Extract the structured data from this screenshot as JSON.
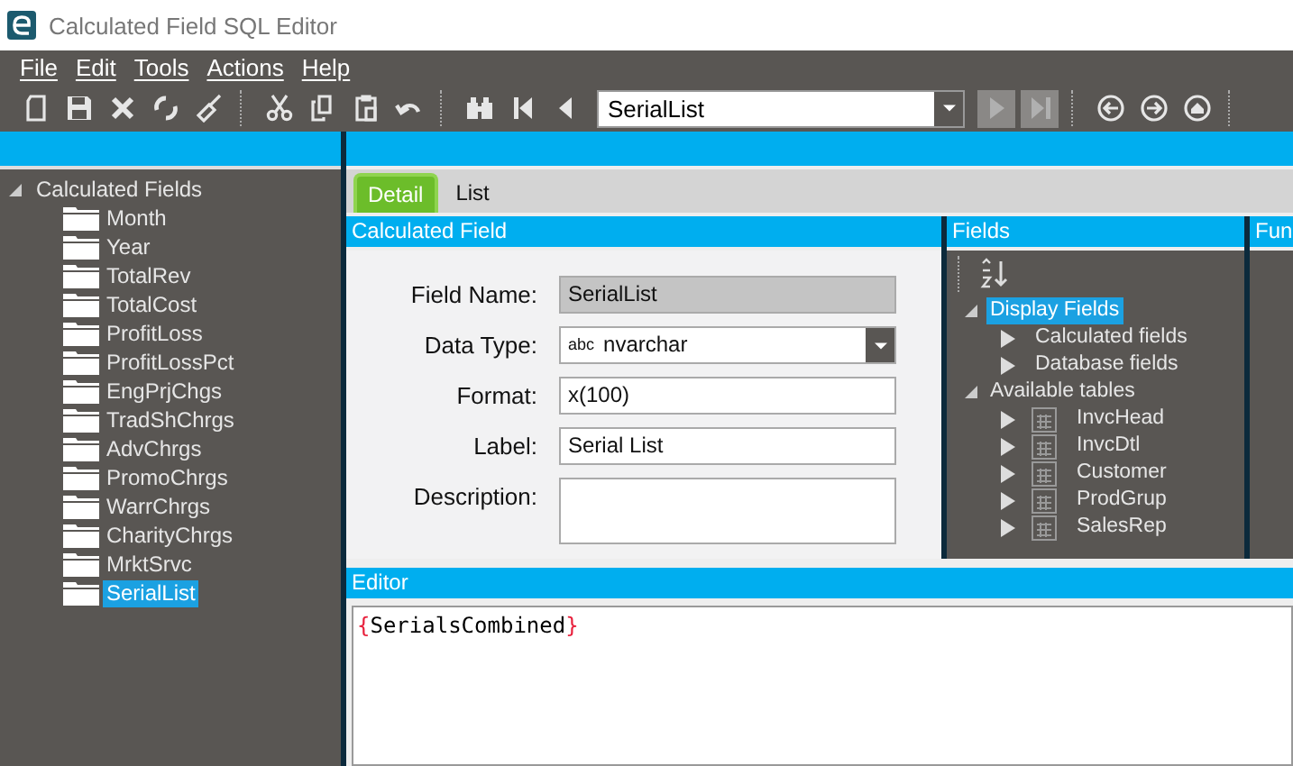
{
  "window": {
    "title": "Calculated Field SQL Editor"
  },
  "menu": [
    "File",
    "Edit",
    "Tools",
    "Actions",
    "Help"
  ],
  "toolbar": [
    {
      "kind": "new",
      "disabled": false
    },
    {
      "kind": "save",
      "disabled": false
    },
    {
      "kind": "delete",
      "disabled": false
    },
    {
      "kind": "refresh",
      "disabled": false
    },
    {
      "kind": "clear",
      "disabled": false
    },
    {
      "kind": "sep"
    },
    {
      "kind": "cut",
      "disabled": false
    },
    {
      "kind": "copy",
      "disabled": false
    },
    {
      "kind": "paste",
      "disabled": false
    },
    {
      "kind": "undo",
      "disabled": false
    },
    {
      "kind": "sep"
    },
    {
      "kind": "find",
      "disabled": false
    },
    {
      "kind": "first",
      "disabled": false
    },
    {
      "kind": "prev",
      "disabled": false
    },
    {
      "kind": "combo",
      "value": "SerialList"
    },
    {
      "kind": "next",
      "disabled": true
    },
    {
      "kind": "last",
      "disabled": true
    },
    {
      "kind": "sep"
    },
    {
      "kind": "back",
      "disabled": false
    },
    {
      "kind": "forward",
      "disabled": false
    },
    {
      "kind": "home",
      "disabled": false
    },
    {
      "kind": "sep"
    }
  ],
  "tree": {
    "label": "Calculated Fields",
    "expanded": true,
    "children": [
      {
        "label": "Month",
        "selected": false
      },
      {
        "label": "Year",
        "selected": false
      },
      {
        "label": "TotalRev",
        "selected": false
      },
      {
        "label": "TotalCost",
        "selected": false
      },
      {
        "label": "ProfitLoss",
        "selected": false
      },
      {
        "label": "ProfitLossPct",
        "selected": false
      },
      {
        "label": "EngPrjChgs",
        "selected": false
      },
      {
        "label": "TradShChrgs",
        "selected": false
      },
      {
        "label": "AdvChrgs",
        "selected": false
      },
      {
        "label": "PromoChrgs",
        "selected": false
      },
      {
        "label": "WarrChrgs",
        "selected": false
      },
      {
        "label": "CharityChrgs",
        "selected": false
      },
      {
        "label": "MrktSrvc",
        "selected": false
      },
      {
        "label": "SerialList",
        "selected": true
      }
    ]
  },
  "tabs": [
    {
      "label": "Detail",
      "selected": true
    },
    {
      "label": "List",
      "selected": false
    }
  ],
  "calculated_field": {
    "title": "Calculated Field",
    "fields": [
      {
        "kind": "text",
        "label": "Field Name:",
        "value": "SerialList",
        "readonly": true
      },
      {
        "kind": "select",
        "label": "Data Type:",
        "badge": "abc",
        "value": "nvarchar",
        "readonly": false
      },
      {
        "kind": "text",
        "label": "Format:",
        "value": "x(100)",
        "readonly": false
      },
      {
        "kind": "text",
        "label": "Label:",
        "value": "Serial List",
        "readonly": false
      },
      {
        "kind": "textarea",
        "label": "Description:",
        "readonly": false
      }
    ]
  },
  "fields_panel": {
    "title": "Fields",
    "tree": [
      {
        "label": "Display Fields",
        "expanded": true,
        "selected": true,
        "children": [
          {
            "label": "Calculated fields",
            "expanded": false,
            "selected": false
          },
          {
            "label": "Database fields",
            "expanded": false,
            "selected": false
          }
        ]
      },
      {
        "label": "Available tables",
        "expanded": true,
        "selected": false,
        "children": [
          {
            "label": "InvcHead",
            "kind": "table",
            "expanded": false,
            "selected": false
          },
          {
            "label": "InvcDtl",
            "kind": "table",
            "expanded": false,
            "selected": false
          },
          {
            "label": "Customer",
            "kind": "table",
            "expanded": false,
            "selected": false
          },
          {
            "label": "ProdGrup",
            "kind": "table",
            "expanded": false,
            "selected": false
          },
          {
            "label": "SalesRep",
            "kind": "table",
            "expanded": false,
            "selected": false
          }
        ]
      }
    ]
  },
  "functions_panel": {
    "title": "Fun"
  },
  "editor": {
    "title": "Editor",
    "tokens": [
      {
        "kind": "brace",
        "text": "{"
      },
      {
        "kind": "name",
        "text": "SerialsCombined"
      },
      {
        "kind": "brace",
        "text": "}"
      }
    ]
  }
}
